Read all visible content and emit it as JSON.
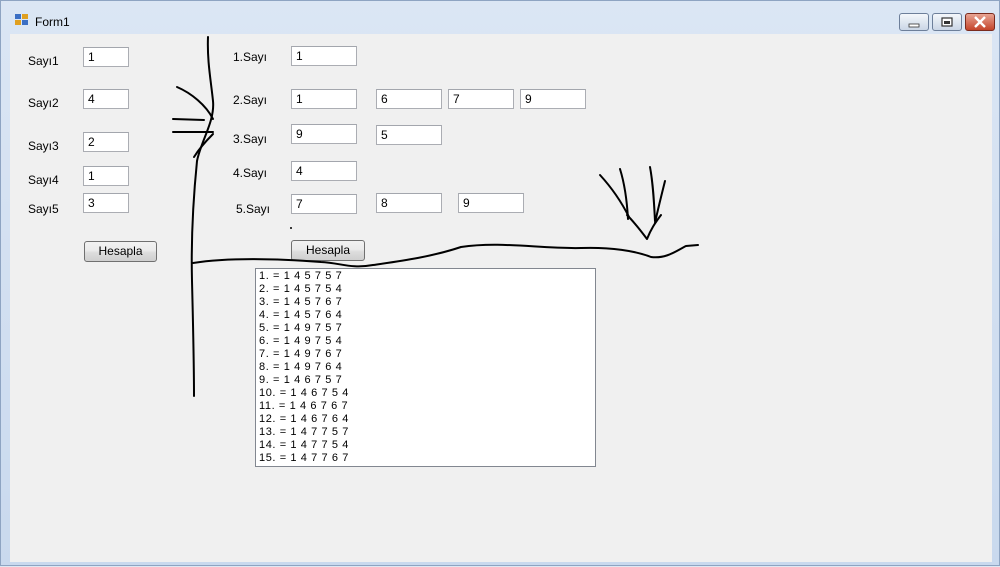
{
  "window": {
    "title": "Form1"
  },
  "left": {
    "labels": [
      "Sayı1",
      "Sayı2",
      "Sayı3",
      "Sayı4",
      "Sayı5"
    ],
    "values": [
      "1",
      "4",
      "2",
      "1",
      "3"
    ],
    "button": "Hesapla"
  },
  "right": {
    "labels": [
      "1.Sayı",
      "2.Sayı",
      "3.Sayı",
      "4.Sayı",
      "5.Sayı"
    ],
    "rows": [
      [
        "1"
      ],
      [
        "1",
        "6",
        "7",
        "9"
      ],
      [
        "9",
        "5"
      ],
      [
        "4"
      ],
      [
        "7",
        "8",
        "9"
      ]
    ],
    "button": "Hesapla"
  },
  "results": [
    "1. = 1 4 5 7 5 7",
    "2. = 1 4 5 7 5 4",
    "3. = 1 4 5 7 6 7",
    "4. = 1 4 5 7 6 4",
    "5. = 1 4 9 7 5 7",
    "6. = 1 4 9 7 5 4",
    "7. = 1 4 9 7 6 7",
    "8. = 1 4 9 7 6 4",
    "9. = 1 4 6 7 5 7",
    "10. = 1 4 6 7 5 4",
    "11. = 1 4 6 7 6 7",
    "12. = 1 4 6 7 6 4",
    "13. = 1 4 7 7 5 7",
    "14. = 1 4 7 7 5 4",
    "15. = 1 4 7 7 6 7"
  ]
}
